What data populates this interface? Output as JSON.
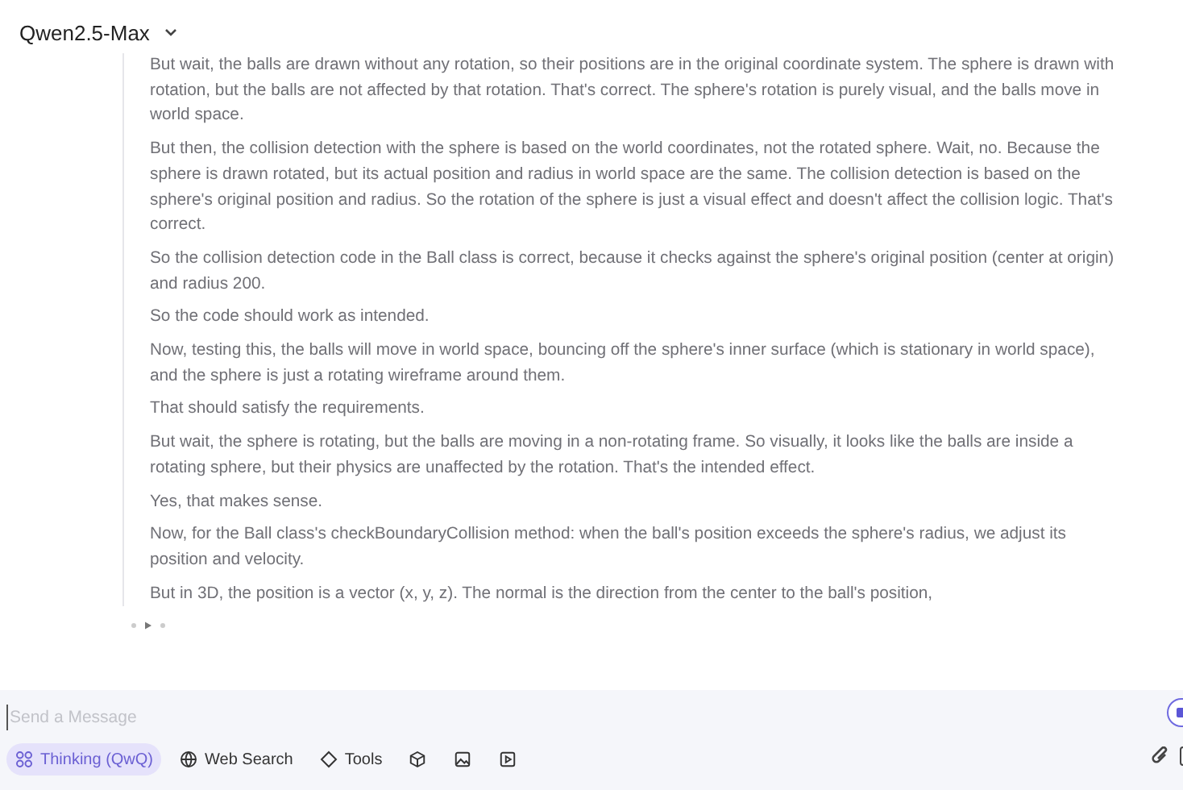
{
  "header": {
    "model": "Qwen2.5-Max"
  },
  "thinking": {
    "paragraphs": [
      "But wait, the balls are drawn without any rotation, so their positions are in the original coordinate system. The sphere is drawn with rotation, but the balls are not affected by that rotation. That's correct. The sphere's rotation is purely visual, and the balls move in world space.",
      "But then, the collision detection with the sphere is based on the world coordinates, not the rotated sphere. Wait, no. Because the sphere is drawn rotated, but its actual position and radius in world space are the same. The collision detection is based on the sphere's original position and radius. So the rotation of the sphere is just a visual effect and doesn't affect the collision logic. That's correct.",
      "So the collision detection code in the Ball class is correct, because it checks against the sphere's original position (center at origin) and radius 200.",
      "So the code should work as intended.",
      "Now, testing this, the balls will move in world space, bouncing off the sphere's inner surface (which is stationary in world space), and the sphere is just a rotating wireframe around them.",
      "That should satisfy the requirements.",
      "But wait, the sphere is rotating, but the balls are moving in a non-rotating frame. So visually, it looks like the balls are inside a rotating sphere, but their physics are unaffected by the rotation. That's the intended effect.",
      "Yes, that makes sense.",
      "Now, for the Ball class's checkBoundaryCollision method: when the ball's position exceeds the sphere's radius, we adjust its position and velocity.",
      "But in 3D, the position is a vector (x, y, z). The normal is the direction from the center to the ball's position,"
    ]
  },
  "composer": {
    "placeholder": "Send a Message",
    "tools": [
      {
        "kind": "thinking",
        "label": "Thinking (QwQ)",
        "selected": true
      },
      {
        "kind": "globe",
        "label": "Web Search",
        "selected": false
      },
      {
        "kind": "tools",
        "label": "Tools",
        "selected": false
      },
      {
        "kind": "cube",
        "selected": false
      },
      {
        "kind": "image",
        "selected": false
      },
      {
        "kind": "video",
        "selected": false
      }
    ]
  }
}
